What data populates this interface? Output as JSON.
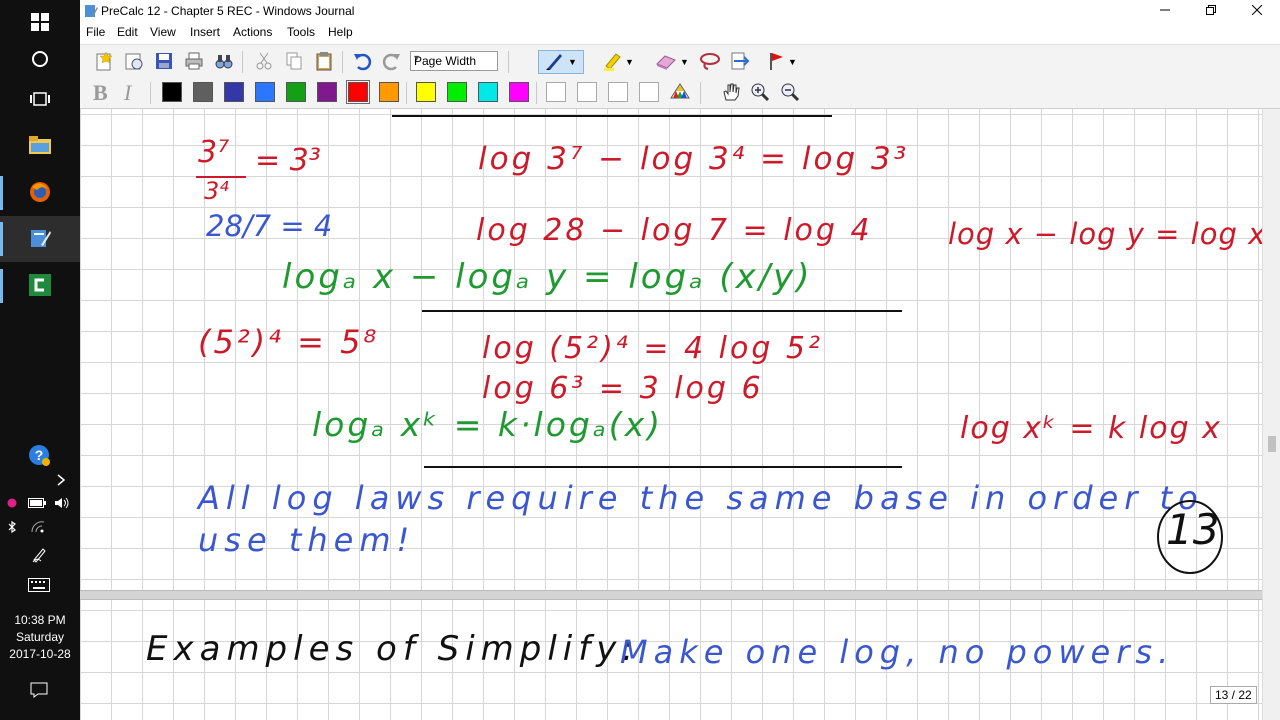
{
  "window": {
    "title": "PreCalc 12 - Chapter 5 REC - Windows Journal",
    "menu": [
      "File",
      "Edit",
      "View",
      "Insert",
      "Actions",
      "Tools",
      "Help"
    ],
    "zoom": "Page Width",
    "page_indicator": "13 / 22"
  },
  "taskbar": {
    "time": "10:38 PM",
    "day": "Saturday",
    "date": "2017-10-28"
  },
  "palette": [
    "#000000",
    "#5f5f5f",
    "#3337a8",
    "#2b78ff",
    "#14a014",
    "#80188e",
    "#ff0000",
    "#ff9900",
    "#ffff00",
    "#00ee00",
    "#00e8e8",
    "#ff00ff",
    "#ffffff",
    "#ffffff",
    "#ffffff",
    "#ffffff"
  ],
  "notes": {
    "l1_left_num": "3⁷",
    "l1_left_den": "3⁴",
    "l1_left_rhs": "= 3³",
    "l1_mid": "log 3⁷ − log 3⁴ = log 3³",
    "l2_left": "28/7 = 4",
    "l2_mid": "log 28 − log 7 = log 4",
    "l2_right": "log x − log y = log x/y",
    "law1": "logₐ x − logₐ y = logₐ (x/y)",
    "l3_left": "(5²)⁴ = 5⁸",
    "l3_mid": "log (5²)⁴ = 4 log 5²",
    "l4_mid": "log 6³ = 3 log 6",
    "law2": "logₐ xᵏ = k·logₐ(x)",
    "l4_right": "log xᵏ = k log x",
    "rule_text_1": "All log laws require the same base in order to",
    "rule_text_2": "use them!",
    "page_number": "13",
    "examples_label": "Examples of Simplify:",
    "examples_instruction": "Make one log, no powers."
  }
}
